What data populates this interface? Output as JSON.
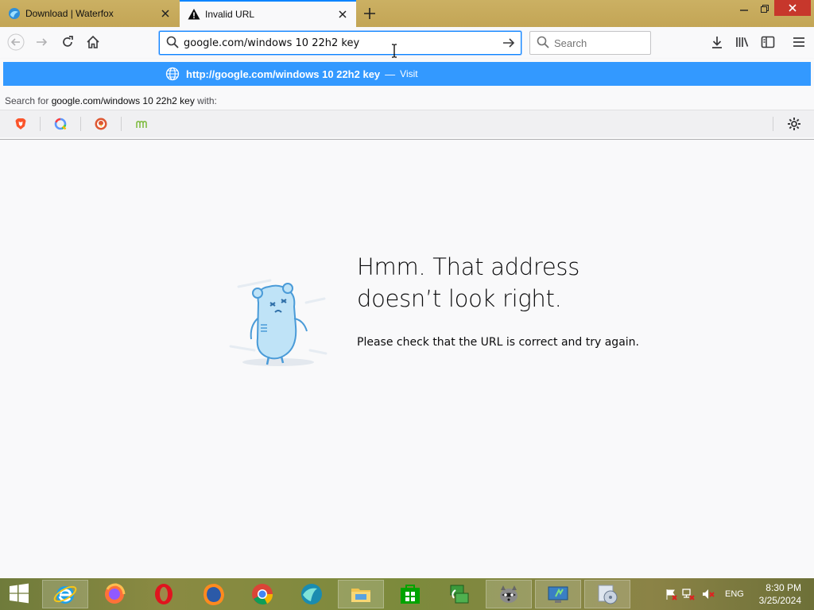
{
  "tabs": [
    {
      "title": "Download | Waterfox",
      "active": false
    },
    {
      "title": "Invalid URL",
      "active": true
    }
  ],
  "urlbar": {
    "value": "google.com/windows 10 22h2 key"
  },
  "searchbar": {
    "placeholder": "Search"
  },
  "popup": {
    "url": "http://google.com/windows 10 22h2 key",
    "dash": "—",
    "action": "Visit",
    "search_prefix": "Search for",
    "search_term": "google.com/windows 10 22h2 key",
    "search_suffix": "with:",
    "engines": [
      "brave-icon",
      "qwant-icon",
      "duckduckgo-icon",
      "mojeek-icon"
    ]
  },
  "error": {
    "title_line1": "Hmm. That address",
    "title_line2": "doesn’t look right.",
    "message": "Please check that the URL is correct and try again."
  },
  "taskbar": {
    "apps": [
      "internet-explorer-icon",
      "firefox-icon",
      "opera-icon",
      "firefox-icon",
      "chrome-icon",
      "waterfox-icon",
      "file-explorer-icon",
      "store-icon",
      "network-icon",
      "raccoon-app-icon",
      "desktop-app-icon",
      "media-icon"
    ],
    "language": "ENG",
    "time": "8:30 PM",
    "date": "3/25/2024"
  },
  "colors": {
    "accent": "#0a84ff",
    "highlight": "#3399ff",
    "titlebar": "#c6a95a"
  }
}
